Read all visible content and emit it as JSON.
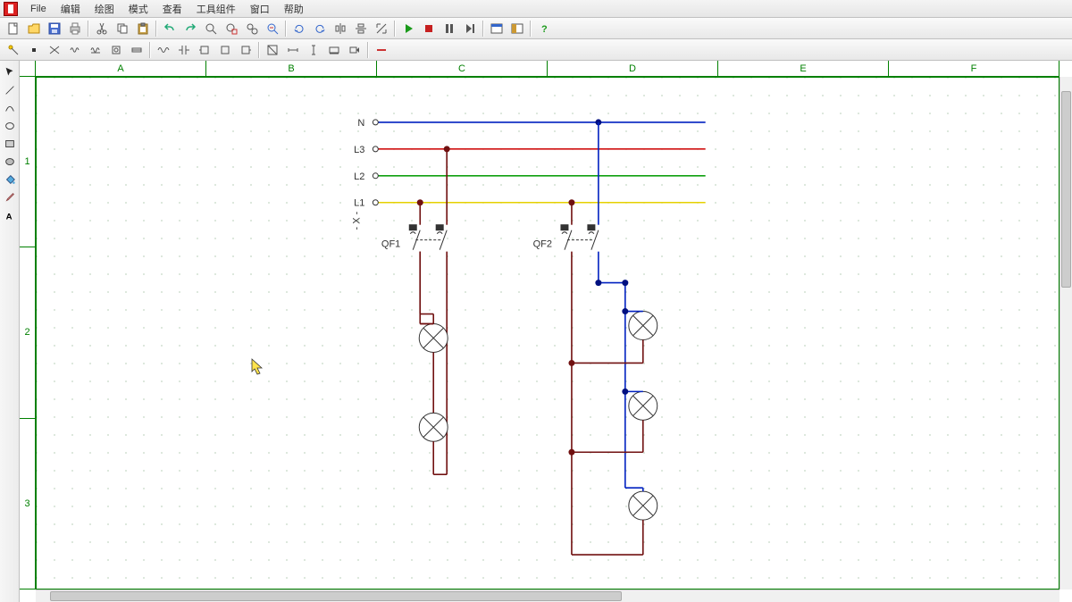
{
  "menu": {
    "file": "File",
    "edit": "编辑",
    "draw": "绘图",
    "mode": "模式",
    "view": "查看",
    "tools": "工具组件",
    "window": "窗口",
    "help": "帮助"
  },
  "toolbar1": {
    "new": "new-file",
    "open": "open-file",
    "save": "save-file",
    "print": "print",
    "cut": "cut",
    "copy": "copy",
    "paste": "paste",
    "undo": "undo",
    "redo": "redo",
    "zoom": "zoom",
    "zoomwin": "zoom-window",
    "zoomext": "zoom-extents",
    "find": "find",
    "rotcw": "rotate-cw",
    "rotccw": "rotate-ccw",
    "mirrorh": "mirror-h",
    "mirrorv": "mirror-v",
    "scale": "scale",
    "play": "run",
    "stop": "stop",
    "pause": "pause",
    "step": "step",
    "win1": "win-toggle",
    "win2": "panel-toggle",
    "helpq": "help"
  },
  "toolbar2": {
    "probe": "probe",
    "node": "node",
    "ground": "ground",
    "coil": "coil1",
    "coil2": "coil2",
    "relay": "relay",
    "fuse": "fuse",
    "wave": "waveform",
    "cap": "capacitor",
    "square": "sq-left",
    "sqc": "sq-center",
    "sqr": "sq-right",
    "dim": "dimension",
    "dimh": "dim-horiz",
    "dimv": "dim-vert",
    "boxd": "box-dim",
    "label": "label",
    "minus": "line-tool"
  },
  "lefttools": {
    "sel": "select",
    "line": "line",
    "curve": "curve",
    "circle": "circle",
    "rect": "rect",
    "poly": "polygon",
    "paint": "paint-bucket",
    "dropper": "dropper",
    "text": "text"
  },
  "ruler": {
    "cols": [
      "A",
      "B",
      "C",
      "D",
      "E",
      "F"
    ],
    "rows": [
      "1",
      "2",
      "3"
    ]
  },
  "circuit": {
    "supply": {
      "n": "N",
      "l3": "L3",
      "l2": "L2",
      "l1": "L1",
      "x": "- X -"
    },
    "breakers": {
      "qf1": "QF1",
      "qf2": "QF2"
    }
  }
}
